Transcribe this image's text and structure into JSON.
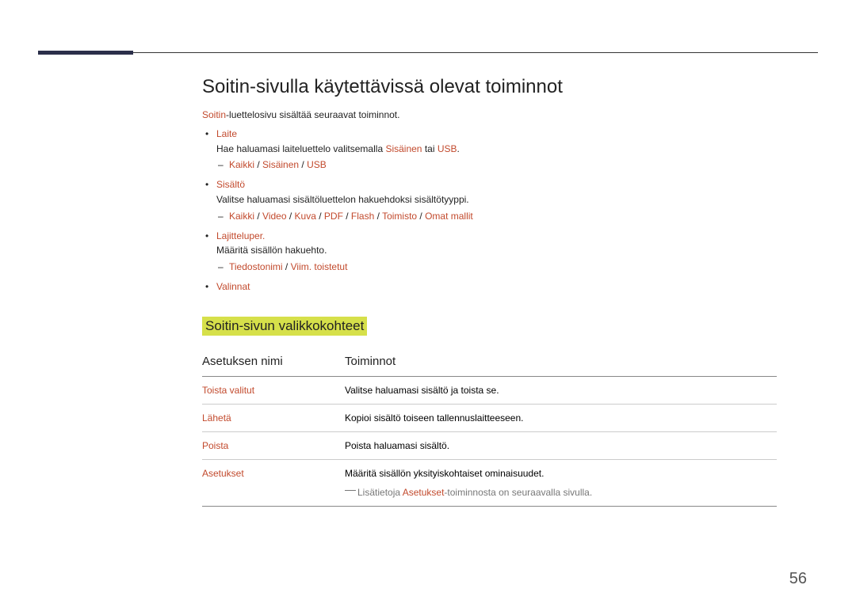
{
  "heading": "Soitin-sivulla käytettävissä olevat toiminnot",
  "intro": {
    "hl": "Soitin",
    "rest": "-luettelosivu sisältää seuraavat toiminnot."
  },
  "items": {
    "laite": {
      "label": "Laite",
      "desc_pre": "Hae haluamasi laiteluettelo valitsemalla ",
      "opt1": "Sisäinen",
      "mid": " tai ",
      "opt2": "USB",
      "dot": ".",
      "sub": [
        "Kaikki",
        "Sisäinen",
        "USB"
      ]
    },
    "sisalto": {
      "label": "Sisältö",
      "desc": "Valitse haluamasi sisältöluettelon hakuehdoksi sisältötyyppi.",
      "sub": [
        "Kaikki",
        "Video",
        "Kuva",
        "PDF",
        "Flash",
        "Toimisto",
        "Omat mallit"
      ]
    },
    "lajittelu": {
      "label": "Lajitteluper.",
      "desc": "Määritä sisällön hakuehto.",
      "sub": [
        "Tiedostonimi",
        "Viim. toistetut"
      ]
    },
    "valinnat": {
      "label": "Valinnat"
    }
  },
  "subheading": "Soitin-sivun valikkokohteet",
  "table": {
    "head": {
      "name": "Asetuksen nimi",
      "func": "Toiminnot"
    },
    "rows": [
      {
        "name": "Toista valitut",
        "func": "Valitse haluamasi sisältö ja toista se."
      },
      {
        "name": "Lähetä",
        "func": "Kopioi sisältö toiseen tallennuslaitteeseen."
      },
      {
        "name": "Poista",
        "func": "Poista haluamasi sisältö."
      },
      {
        "name": "Asetukset",
        "func": "Määritä sisällön yksityiskohtaiset ominaisuudet.",
        "note_pre": "Lisätietoja ",
        "note_hl": "Asetukset",
        "note_post": "-toiminnosta on seuraavalla sivulla."
      }
    ]
  },
  "sep": " / ",
  "page_number": "56"
}
